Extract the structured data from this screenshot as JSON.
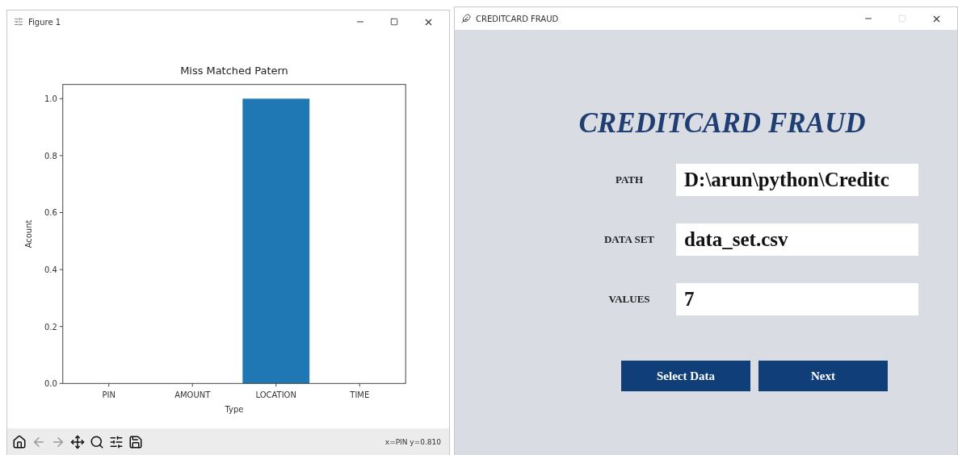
{
  "figure_window": {
    "title": "Figure 1",
    "maximize_disabled": false,
    "chart_data": {
      "type": "bar",
      "title": "Miss Matched Patern",
      "xlabel": "Type",
      "ylabel": "Acount",
      "categories": [
        "PIN",
        "AMOUNT",
        "LOCATION",
        "TIME"
      ],
      "series": [
        {
          "color": "#1f77b4",
          "values": [
            0,
            0,
            1,
            0
          ]
        }
      ],
      "ylim": [
        0,
        1.05
      ],
      "yticks": [
        {
          "value": 0,
          "label": "0.0"
        },
        {
          "value": 0.2,
          "label": "0.2"
        },
        {
          "value": 0.4,
          "label": "0.4"
        },
        {
          "value": 0.6,
          "label": "0.6"
        },
        {
          "value": 0.8,
          "label": "0.8"
        },
        {
          "value": 1,
          "label": "1.0"
        }
      ]
    },
    "toolbar": [
      {
        "kind": "home",
        "disabled": false
      },
      {
        "kind": "back",
        "disabled": true
      },
      {
        "kind": "forward",
        "disabled": true
      },
      {
        "kind": "pan",
        "disabled": false
      },
      {
        "kind": "zoom",
        "disabled": false
      },
      {
        "kind": "configure",
        "disabled": false
      },
      {
        "kind": "save",
        "disabled": false
      }
    ],
    "status": "x=PIN y=0.810"
  },
  "app_window": {
    "title": "CREDITCARD FRAUD",
    "maximize_disabled": true,
    "heading": "CREDITCARD FRAUD",
    "fields": [
      {
        "label": "PATH",
        "value": "D:\\arun\\python\\Creditc"
      },
      {
        "label": "DATA SET",
        "value": "data_set.csv"
      },
      {
        "label": "VALUES",
        "value": "7"
      }
    ],
    "buttons": [
      "Select Data",
      "Next"
    ]
  }
}
